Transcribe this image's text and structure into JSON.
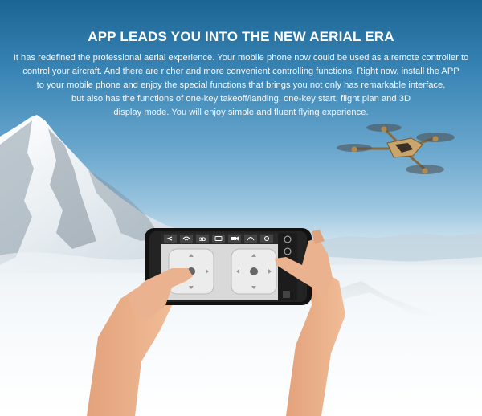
{
  "header": {
    "title": "APP LEADS YOU INTO THE NEW AERIAL ERA"
  },
  "description": {
    "lines": [
      "It has redefined the professional aerial experience. Your mobile phone now could be used as a remote controller to",
      "control your aircraft. And there are richer and more convenient controlling functions. Right now, install the  APP",
      "to your mobile phone and enjoy the special functions that brings you not only has remarkable interface,",
      "but also has the functions of one-key takeoff/landing, one-key start, flight plan and 3D",
      "display mode. You will enjoy simple and fluent flying experience."
    ]
  },
  "app_toolbar": {
    "mode_label": "3D",
    "icons": [
      "back-icon",
      "wifi-icon",
      "3d-mode-icon",
      "camera-icon",
      "video-icon",
      "flip-icon",
      "settings-icon"
    ]
  },
  "colors": {
    "sky_top": "#1b6594",
    "drone_body": "#c9a46b",
    "app_screen": "#d9d9d9",
    "stop_button": "#d0192b"
  }
}
